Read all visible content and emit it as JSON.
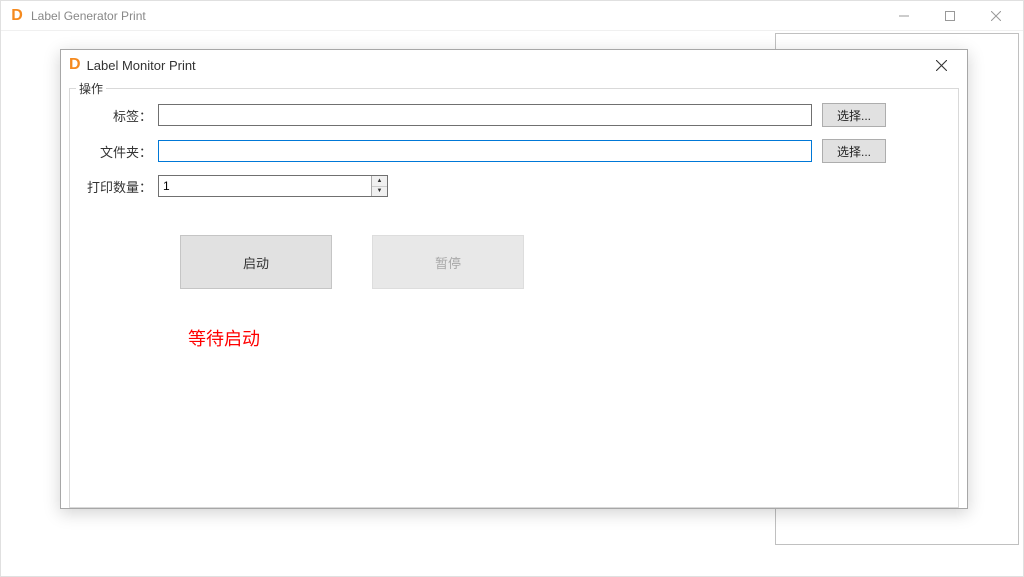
{
  "parent": {
    "title": "Label Generator Print"
  },
  "dialog": {
    "title": "Label Monitor Print",
    "group_label": "操作",
    "labels": {
      "tag": "标签：",
      "folder": "文件夹：",
      "qty": "打印数量："
    },
    "inputs": {
      "tag_value": "",
      "folder_value": "",
      "qty_value": "1"
    },
    "buttons": {
      "browse": "选择...",
      "start": "启动",
      "pause": "暂停"
    },
    "status": "等待启动"
  }
}
